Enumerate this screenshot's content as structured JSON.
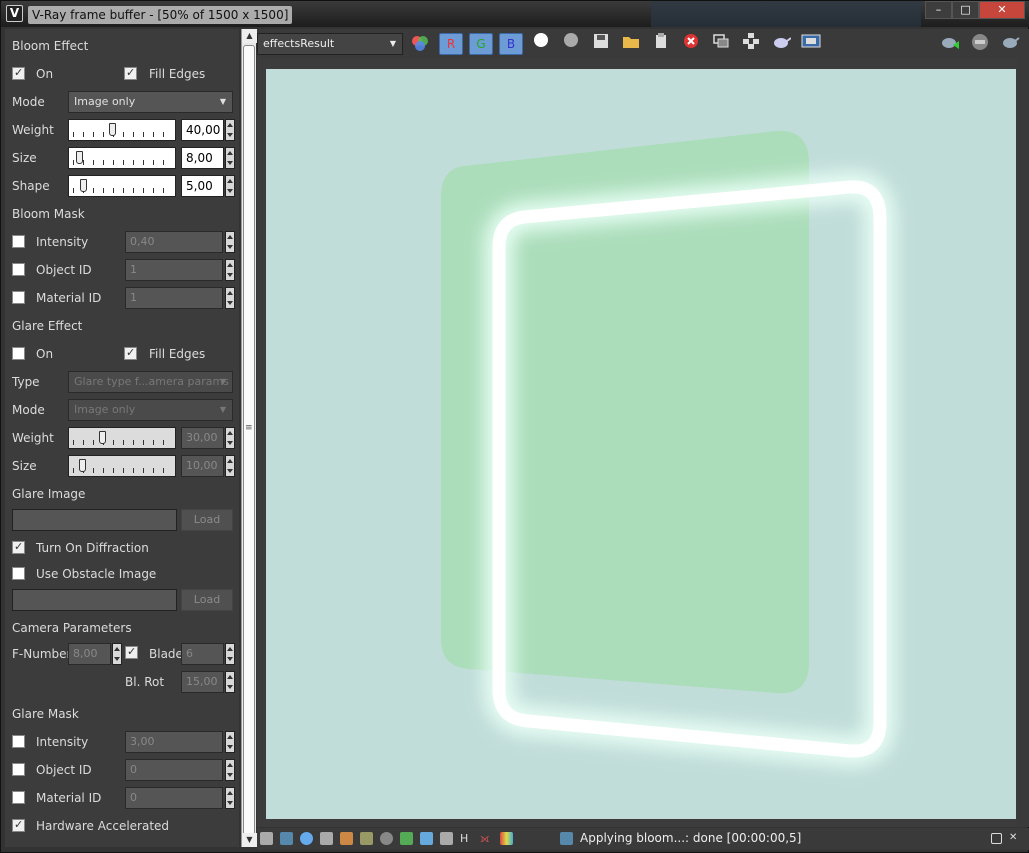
{
  "window": {
    "title": "V-Ray frame buffer - [50% of 1500 x 1500]",
    "controls": {
      "minimize": "–",
      "maximize": "□",
      "close": "✕"
    }
  },
  "bloom_effect": {
    "heading": "Bloom Effect",
    "on_label": "On",
    "on_checked": true,
    "fill_edges_label": "Fill Edges",
    "fill_edges_checked": true,
    "mode_label": "Mode",
    "mode_value": "Image only",
    "weight_label": "Weight",
    "weight_value": "40,00",
    "weight_level": 0.4,
    "size_label": "Size",
    "size_value": "8,00",
    "size_level": 0.08,
    "shape_label": "Shape",
    "shape_value": "5,00",
    "shape_level": 0.05
  },
  "bloom_mask": {
    "heading": "Bloom Mask",
    "intensity_label": "Intensity",
    "intensity_value": "0,40",
    "object_id_label": "Object ID",
    "object_id_value": "1",
    "material_id_label": "Material ID",
    "material_id_value": "1"
  },
  "glare_effect": {
    "heading": "Glare Effect",
    "on_label": "On",
    "on_checked": false,
    "fill_edges_label": "Fill Edges",
    "fill_edges_checked": true,
    "type_label": "Type",
    "type_value": "Glare type f...amera params",
    "mode_label": "Mode",
    "mode_value": "Image only",
    "weight_label": "Weight",
    "weight_value": "30,00",
    "weight_level": 0.3,
    "size_label": "Size",
    "size_value": "10,00",
    "size_level": 0.1
  },
  "glare_image": {
    "heading": "Glare Image",
    "load_label": "Load",
    "diffraction_label": "Turn On Diffraction",
    "diffraction_checked": true,
    "obstacle_label": "Use Obstacle Image",
    "obstacle_checked": false,
    "load2_label": "Load"
  },
  "camera_params": {
    "heading": "Camera Parameters",
    "fnumber_label": "F-Number",
    "fnumber_value": "8,00",
    "blade_checked": true,
    "blade_label": "Blade",
    "blade_value": "6",
    "blrot_label": "Bl. Rot",
    "blrot_value": "15,00"
  },
  "glare_mask": {
    "heading": "Glare Mask",
    "intensity_label": "Intensity",
    "intensity_value": "3,00",
    "object_id_label": "Object ID",
    "object_id_value": "0",
    "material_id_label": "Material ID",
    "material_id_value": "0",
    "hw_label": "Hardware Accelerated",
    "hw_checked": true
  },
  "toolbar": {
    "channel_select": "effectsResult",
    "r_label": "R",
    "g_label": "G",
    "b_label": "B"
  },
  "status": {
    "text": "Applying bloom...: done [00:00:00,5]"
  },
  "colors": {
    "canvas_bg": "#c1ddd9",
    "green_panel": "#a9dcb7",
    "glow": "#ffffff",
    "channel_button": "#6d9bd6"
  }
}
